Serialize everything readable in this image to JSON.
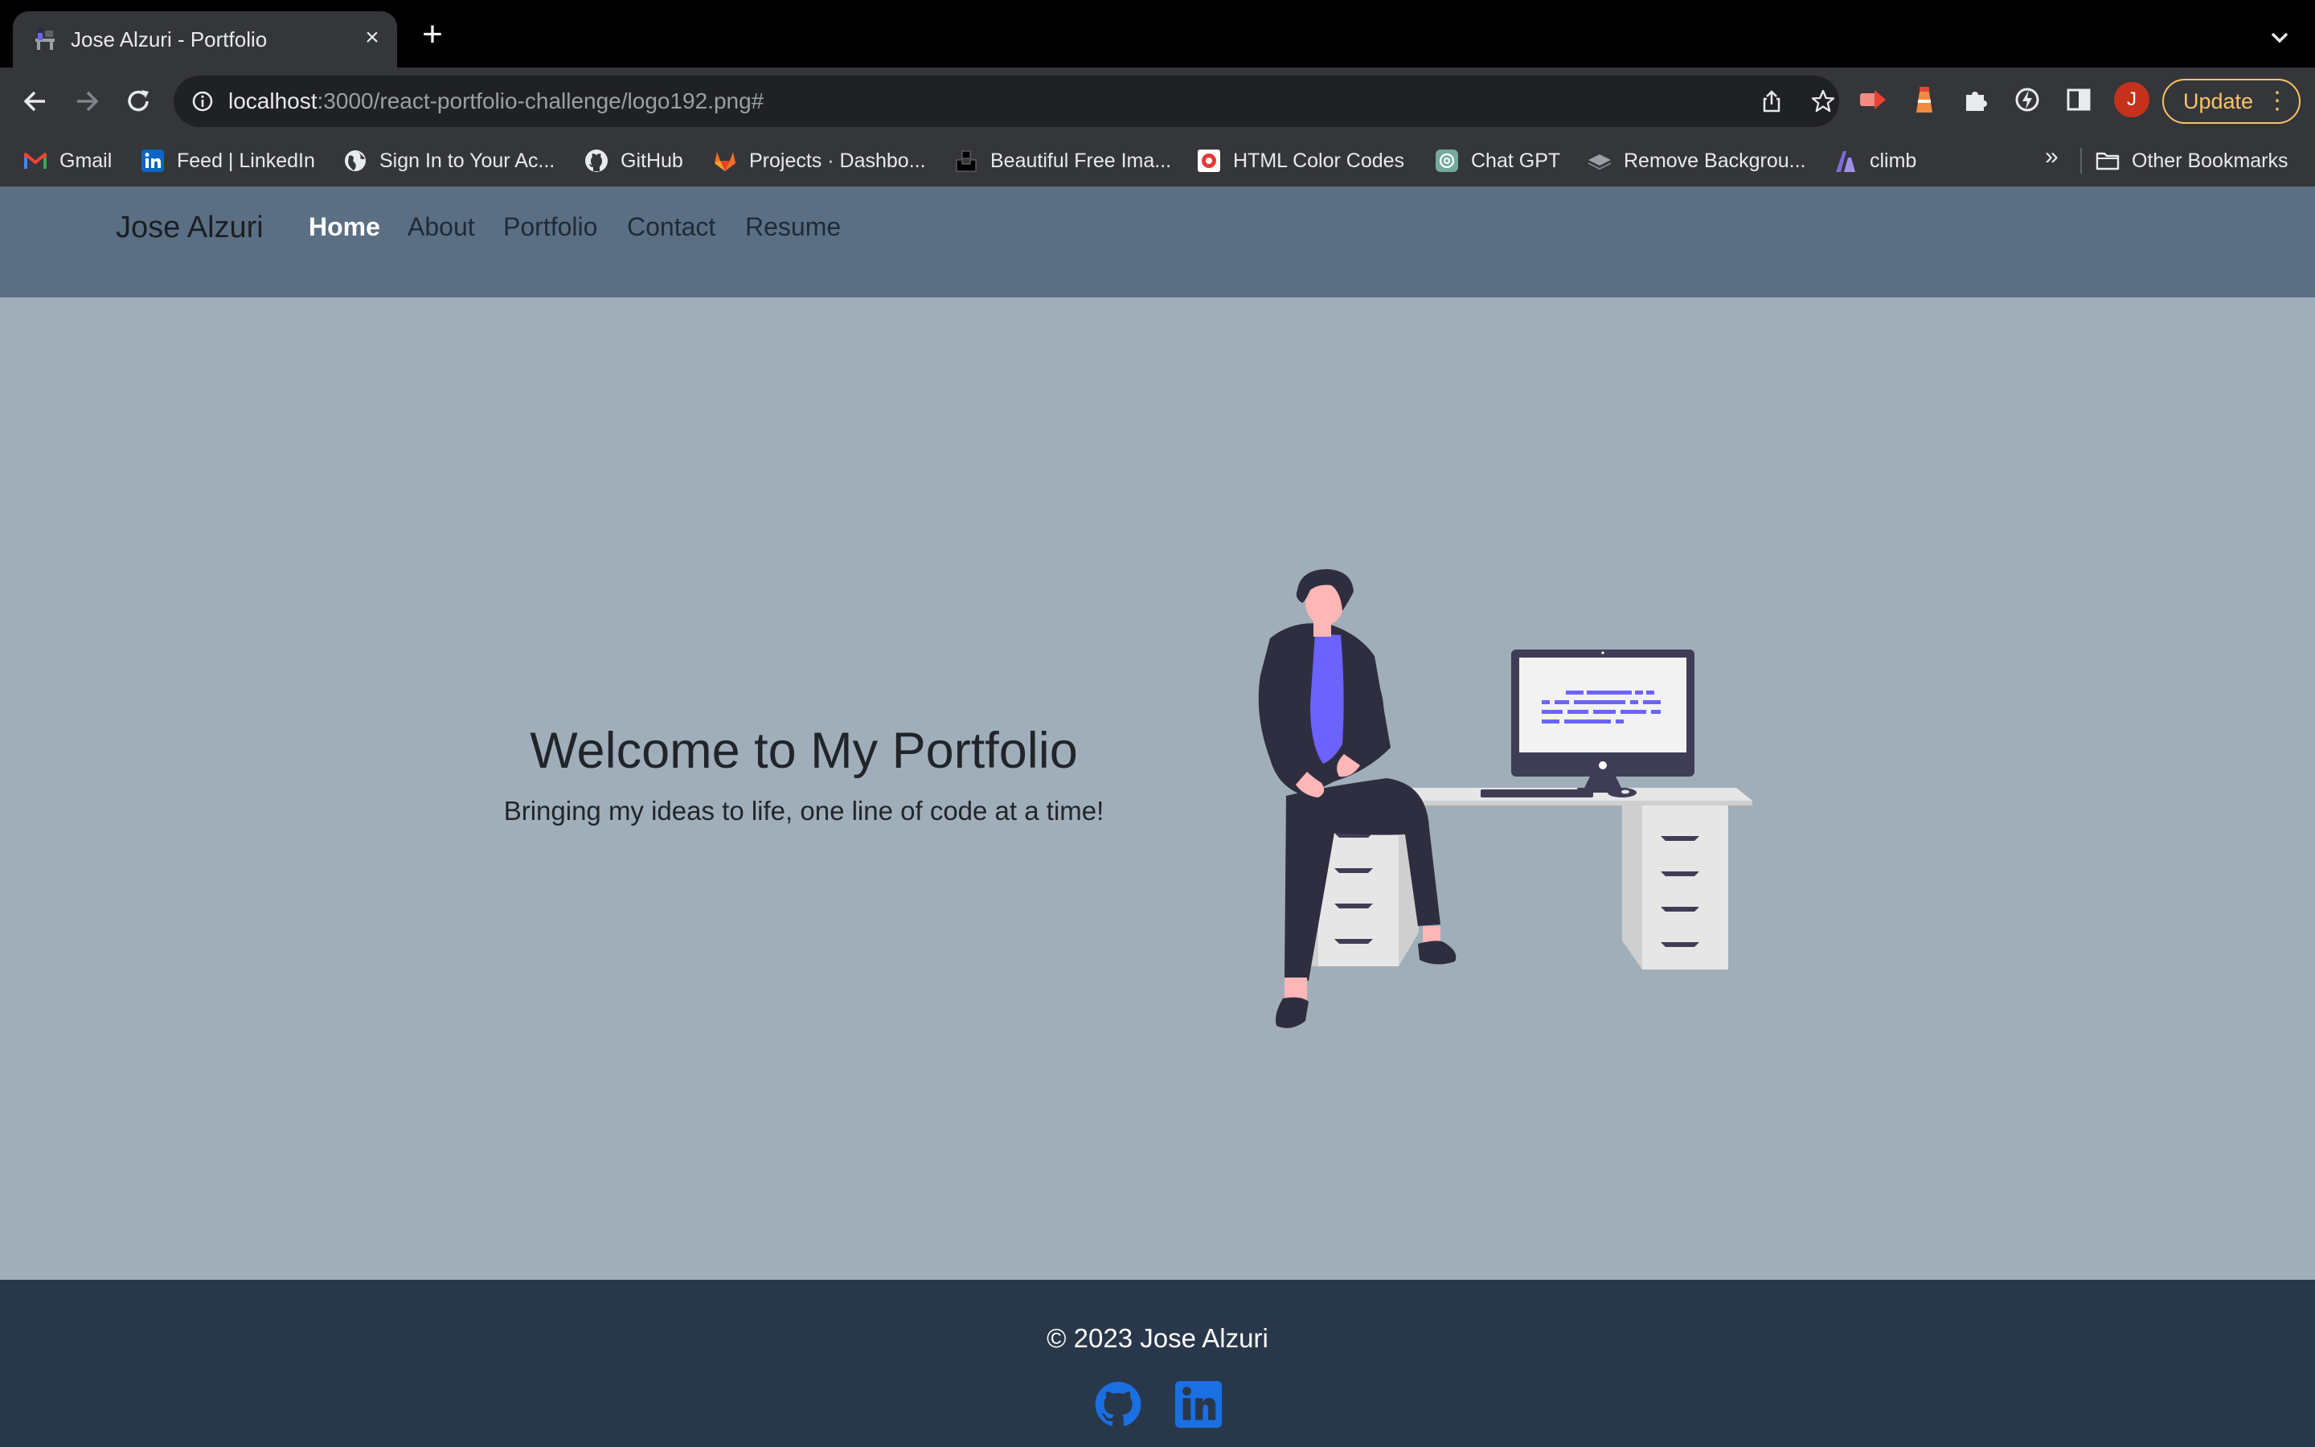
{
  "browser": {
    "tab": {
      "title": "Jose Alzuri - Portfolio"
    },
    "url": {
      "host": "localhost",
      "path": ":3000/react-portfolio-challenge/logo192.png#"
    },
    "update_label": "Update",
    "avatar_initial": "J",
    "bookmarks": [
      {
        "label": "Gmail",
        "icon": "gmail-icon"
      },
      {
        "label": "Feed | LinkedIn",
        "icon": "linkedin-icon"
      },
      {
        "label": "Sign In to Your Ac...",
        "icon": "globe-icon"
      },
      {
        "label": "GitHub",
        "icon": "github-icon"
      },
      {
        "label": "Projects · Dashbo...",
        "icon": "gitlab-icon"
      },
      {
        "label": "Beautiful Free Ima...",
        "icon": "unsplash-icon"
      },
      {
        "label": "HTML Color Codes",
        "icon": "color-picker-icon"
      },
      {
        "label": "Chat GPT",
        "icon": "chatgpt-icon"
      },
      {
        "label": "Remove Backgrou...",
        "icon": "layers-icon"
      },
      {
        "label": "climb",
        "icon": "climb-icon"
      }
    ],
    "more_bookmarks": "»",
    "other_bookmarks": "Other Bookmarks"
  },
  "site": {
    "brand": "Jose Alzuri",
    "nav": [
      {
        "label": "Home",
        "active": true
      },
      {
        "label": "About"
      },
      {
        "label": "Portfolio"
      },
      {
        "label": "Contact"
      },
      {
        "label": "Resume"
      }
    ],
    "hero": {
      "title": "Welcome to My Portfolio",
      "subtitle": "Bringing my ideas to life, one line of code at a time!"
    },
    "footer": {
      "copyright": "© 2023 Jose Alzuri",
      "social": [
        "github-icon",
        "linkedin-icon"
      ]
    }
  },
  "colors": {
    "nav_bg": "#5b6f84",
    "hero_bg": "#a0aeba",
    "footer_bg": "#29374b",
    "accent_purple": "#6c63ff",
    "social_blue": "#1a6fe3"
  }
}
